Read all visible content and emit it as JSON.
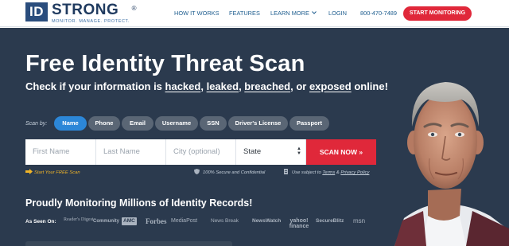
{
  "header": {
    "logo_box": "ID",
    "logo_word": "STRONG",
    "logo_reg": "®",
    "logo_tagline": "MONITOR. MANAGE. PROTECT.",
    "nav": [
      {
        "label": "HOW IT WORKS"
      },
      {
        "label": "FEATURES"
      },
      {
        "label": "LEARN MORE",
        "chevron": "chevron-down-icon"
      },
      {
        "label": "LOGIN"
      },
      {
        "label": "800-470-7489"
      }
    ],
    "cta": "START MONITORING",
    "colors": {
      "brand_blue": "#2a4d7d",
      "nav_blue": "#1f5e8f",
      "cta_red": "#e0283a"
    }
  },
  "hero": {
    "title": "Free Identity Threat Scan",
    "subtitle": {
      "prefix": "Check if your information is ",
      "w1": "hacked",
      "sep1": ", ",
      "w2": "leaked",
      "sep2": ", ",
      "w3": "breached",
      "sep3": ", or ",
      "w4": "exposed",
      "suffix": " online!"
    },
    "scan_by_label": "Scan by:",
    "scan_types": [
      "Name",
      "Phone",
      "Email",
      "Username",
      "SSN",
      "Driver's License",
      "Passport"
    ],
    "active_scan_type": "Name",
    "form": {
      "first_name_placeholder": "First Name",
      "last_name_placeholder": "Last Name",
      "city_placeholder": "City (optional)",
      "state_value": "State",
      "submit_label": "SCAN NOW »"
    },
    "notes": {
      "free": "Start Your FREE Scan",
      "secure": "100% Secure and Confidential",
      "terms_prefix": "Use subject to ",
      "terms": "Terms",
      "and": " & ",
      "privacy": "Privacy Policy"
    },
    "proud": "Proudly Monitoring Millions of Identity Records!",
    "as_seen_on": "As Seen On:",
    "media": [
      "Reader's Digest",
      "Community",
      "AMC",
      "Forbes",
      "MediaPost",
      "News Break",
      "NewsWatch",
      "yahoo! finance",
      "SecureBlitz",
      "msn"
    ],
    "colors": {
      "background": "#2b3a4e",
      "active_pill": "#2c87d8",
      "pill": "#5a6675",
      "accent_yellow": "#f0b428"
    }
  }
}
